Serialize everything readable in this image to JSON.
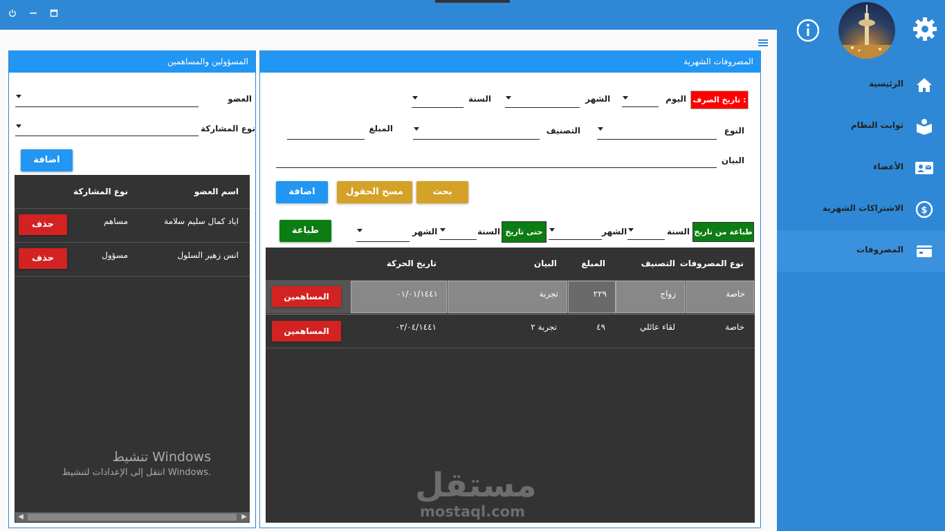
{
  "window": {
    "power_icon": "power-icon",
    "minimize_icon": "minimize-icon",
    "maximize_icon": "maximize-icon"
  },
  "sidebar": {
    "items": [
      {
        "label": "الرئيسية",
        "icon": "home-icon"
      },
      {
        "label": "ثوابت النظام",
        "icon": "book-icon"
      },
      {
        "label": "الأعضاء",
        "icon": "contact-card-icon"
      },
      {
        "label": "الاشتراكات الشهرية",
        "icon": "dollar-icon"
      },
      {
        "label": "المصروفات",
        "icon": "wallet-icon",
        "active": true
      }
    ]
  },
  "expenses": {
    "title": "المصروفات الشهرية",
    "date_tag": "تاريخ الصرف :",
    "day_label": "اليوم",
    "month_label": "الشهر",
    "year_label": "السنة",
    "type_label": "النوع",
    "category_label": "التصنيف",
    "amount_label": "المبلغ",
    "statement_label": "البيان",
    "search_button": "بحث",
    "clear_button": "مسح الحقول",
    "add_button": "اضافة",
    "print_from_tag": "طباعة من تاريخ",
    "to_date_tag": "حتى تاريخ",
    "print_button": "طباعة",
    "columns": [
      "نوع المصروفات",
      "التصنيف",
      "المبلغ",
      "البيان",
      "تاريخ الحركة"
    ],
    "rows": [
      {
        "type": "خاصة",
        "category": "زواج",
        "amount": "٢٢٩",
        "statement": "تجربة",
        "date": "٠١/٠١/١٤٤١",
        "action": "المساهمين"
      },
      {
        "type": "خاصة",
        "category": "لقاء عائلي",
        "amount": "٤٩",
        "statement": "تجربة ٢",
        "date": "٠٢/٠٤/١٤٤١",
        "action": "المساهمين"
      }
    ]
  },
  "contributors": {
    "title": "المسؤولين والمساهمين",
    "member_label": "العضو",
    "participation_label": "نوع المشاركة",
    "add_button": "اضافة",
    "columns": [
      "اسم العضو",
      "نوع المشاركة"
    ],
    "rows": [
      {
        "name": "اياد كمال سليم سلامة",
        "participation": "مساهم",
        "action": "حذف"
      },
      {
        "name": "انس زهير السلول",
        "participation": "مسؤول",
        "action": "حذف"
      }
    ]
  },
  "watermark": {
    "line1": "تنشيط Windows",
    "line2": "انتقل إلى الإعدادات لتنشيط Windows."
  },
  "logo": {
    "arabic": "مستقل",
    "latin": "mostaql.com"
  },
  "colors": {
    "primary": "#2e88d6",
    "header": "#2196f3",
    "gold": "#d4a227",
    "green": "#0b7d12",
    "red": "#d32222",
    "grid": "#333333"
  }
}
